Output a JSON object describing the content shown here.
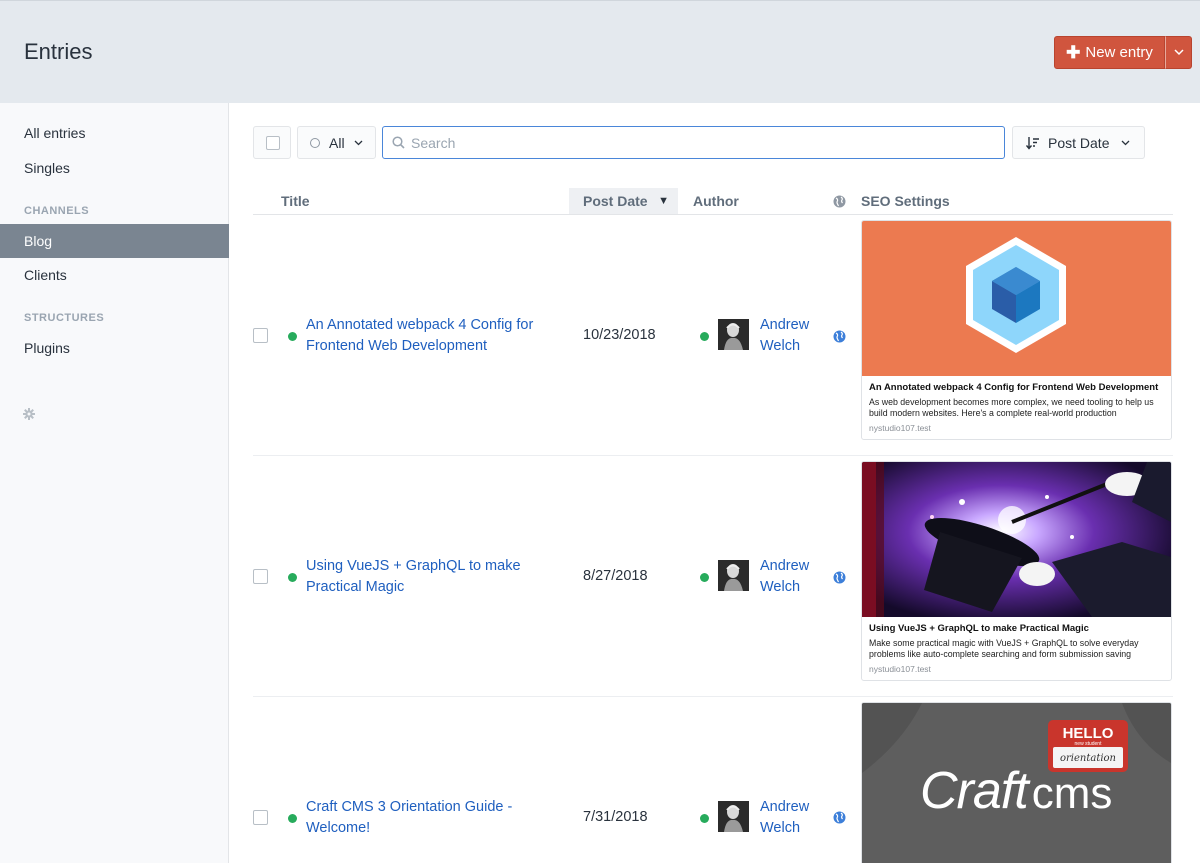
{
  "header": {
    "title": "Entries",
    "new_entry_label": "New entry",
    "accent_color": "#d0553e"
  },
  "sidebar": {
    "items": [
      {
        "label": "All entries"
      },
      {
        "label": "Singles"
      },
      {
        "label": "Blog",
        "active": true
      },
      {
        "label": "Clients"
      },
      {
        "label": "Plugins"
      }
    ],
    "headings": [
      "CHANNELS",
      "STRUCTURES"
    ],
    "settings_icon": "gear-icon"
  },
  "toolbar": {
    "status_label": "All",
    "search_placeholder": "Search",
    "sort_label": "Post Date"
  },
  "table": {
    "columns": [
      "Title",
      "Post Date",
      "Author",
      "SEO Settings"
    ],
    "sort_indicator": "▼",
    "rows": [
      {
        "title": "An Annotated webpack 4 Config for Frontend Web Development",
        "date": "10/23/2018",
        "author": "Andrew Welch",
        "status": "live",
        "seo": {
          "image": "webpack-logo",
          "title": "An Annotated webpack 4 Config for Frontend Web Development",
          "description": "As web development becomes more complex, we need tooling to help us build modern websites. Here's a complete real-world production",
          "site": "nystudio107.test"
        }
      },
      {
        "title": "Using VueJS + GraphQL to make Practical Magic",
        "date": "8/27/2018",
        "author": "Andrew Welch",
        "status": "live",
        "seo": {
          "image": "magic-hat",
          "title": "Using VueJS + GraphQL to make Practical Magic",
          "description": "Make some practical magic with VueJS + GraphQL to solve everyday problems like auto-complete searching and form submission saving",
          "site": "nystudio107.test"
        }
      },
      {
        "title": "Craft CMS 3 Orientation Guide - Welcome!",
        "date": "7/31/2018",
        "author": "Andrew Welch",
        "status": "live",
        "seo": {
          "image": "craft-cms-shirt",
          "image_text": {
            "brand": "Craft",
            "brand_suffix": "cms",
            "badge_hello": "HELLO",
            "badge_small": "new student",
            "badge_hand": "orientation"
          }
        }
      }
    ]
  }
}
